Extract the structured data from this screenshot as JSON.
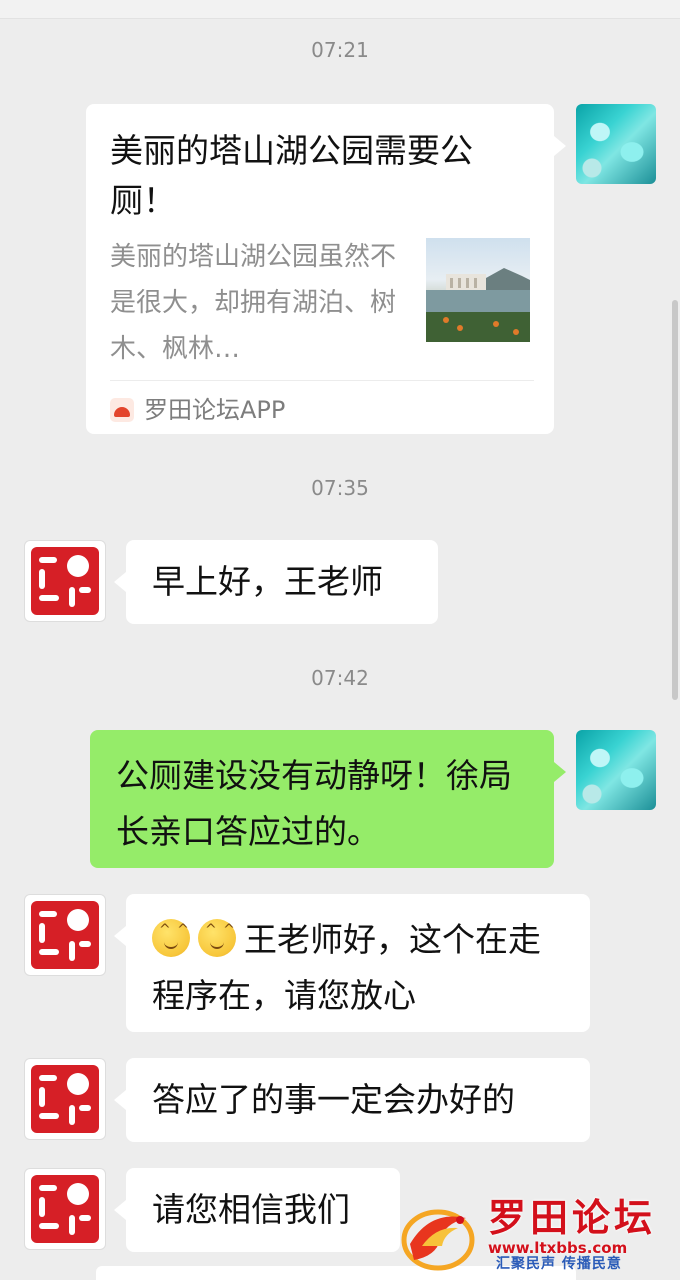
{
  "messages": [
    {
      "time": "07:21"
    },
    {
      "card": {
        "title": "美丽的塔山湖公园需要公厕！",
        "description": "美丽的塔山湖公园虽然不是很大，却拥有湖泊、树木、枫林…",
        "source": "罗田论坛APP"
      }
    },
    {
      "time": "07:35"
    },
    {
      "text": "早上好，王老师"
    },
    {
      "time": "07:42"
    },
    {
      "text": "公厕建设没有动静呀！徐局长亲口答应过的。"
    },
    {
      "text": "王老师好，这个在走程序在，请您放心"
    },
    {
      "text": "答应了的事一定会办好的"
    },
    {
      "text": "请您相信我们"
    }
  ],
  "times": [
    "07:21",
    "07:35",
    "07:42"
  ],
  "card": {
    "title": "美丽的塔山湖公园需要公厕！",
    "description": "美丽的塔山湖公园虽然不是很大，却拥有湖泊、树木、枫林…",
    "source": "罗田论坛APP"
  },
  "bubbles": {
    "greeting": "早上好，王老师",
    "sent_1": "公厕建设没有动静呀！徐局长亲口答应过的。",
    "reply_1": "王老师好，这个在走程序在，请您放心",
    "reply_2": "答应了的事一定会办好的",
    "reply_3": "请您相信我们"
  },
  "emojis": [
    "smile-emoji",
    "smile-emoji"
  ],
  "watermark": {
    "title": "罗田论坛",
    "url": "www.ltxbbs.com",
    "slogan": "汇聚民声  传播民意"
  },
  "colors": {
    "background": "#ededed",
    "outgoing_bubble": "#95ec69",
    "incoming_bubble": "#ffffff",
    "seal_red": "#d61f26",
    "watermark_red": "#d3101b",
    "watermark_blue": "#2a5bb8"
  }
}
